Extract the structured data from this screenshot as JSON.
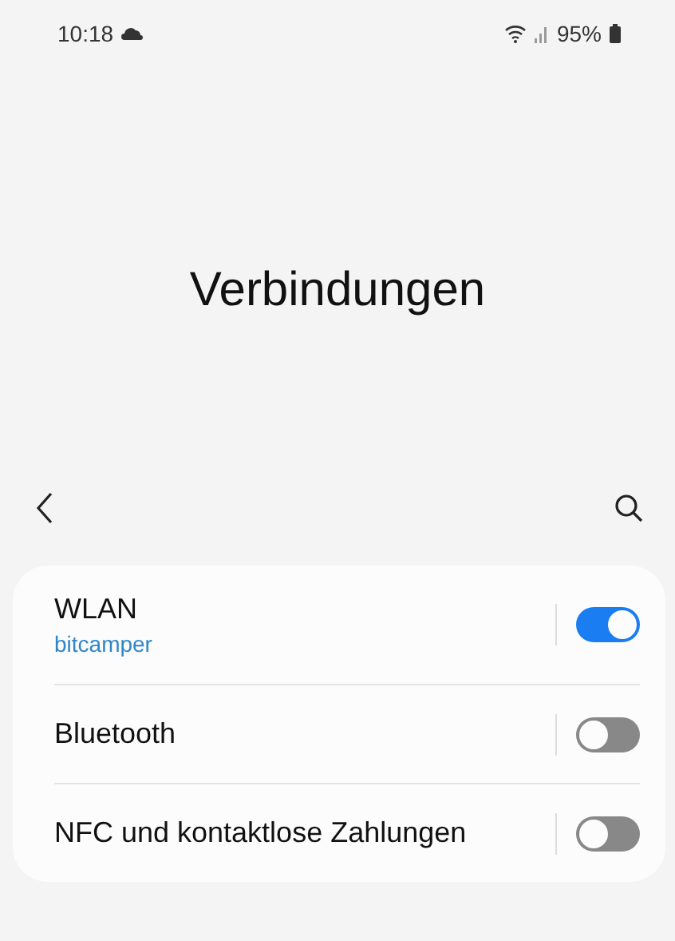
{
  "status_bar": {
    "time": "10:18",
    "battery": "95%"
  },
  "title": "Verbindungen",
  "settings": [
    {
      "label": "WLAN",
      "subtitle": "bitcamper",
      "on": true
    },
    {
      "label": "Bluetooth",
      "on": false
    },
    {
      "label": "NFC und kontaktlose Zahlungen",
      "on": false
    }
  ]
}
